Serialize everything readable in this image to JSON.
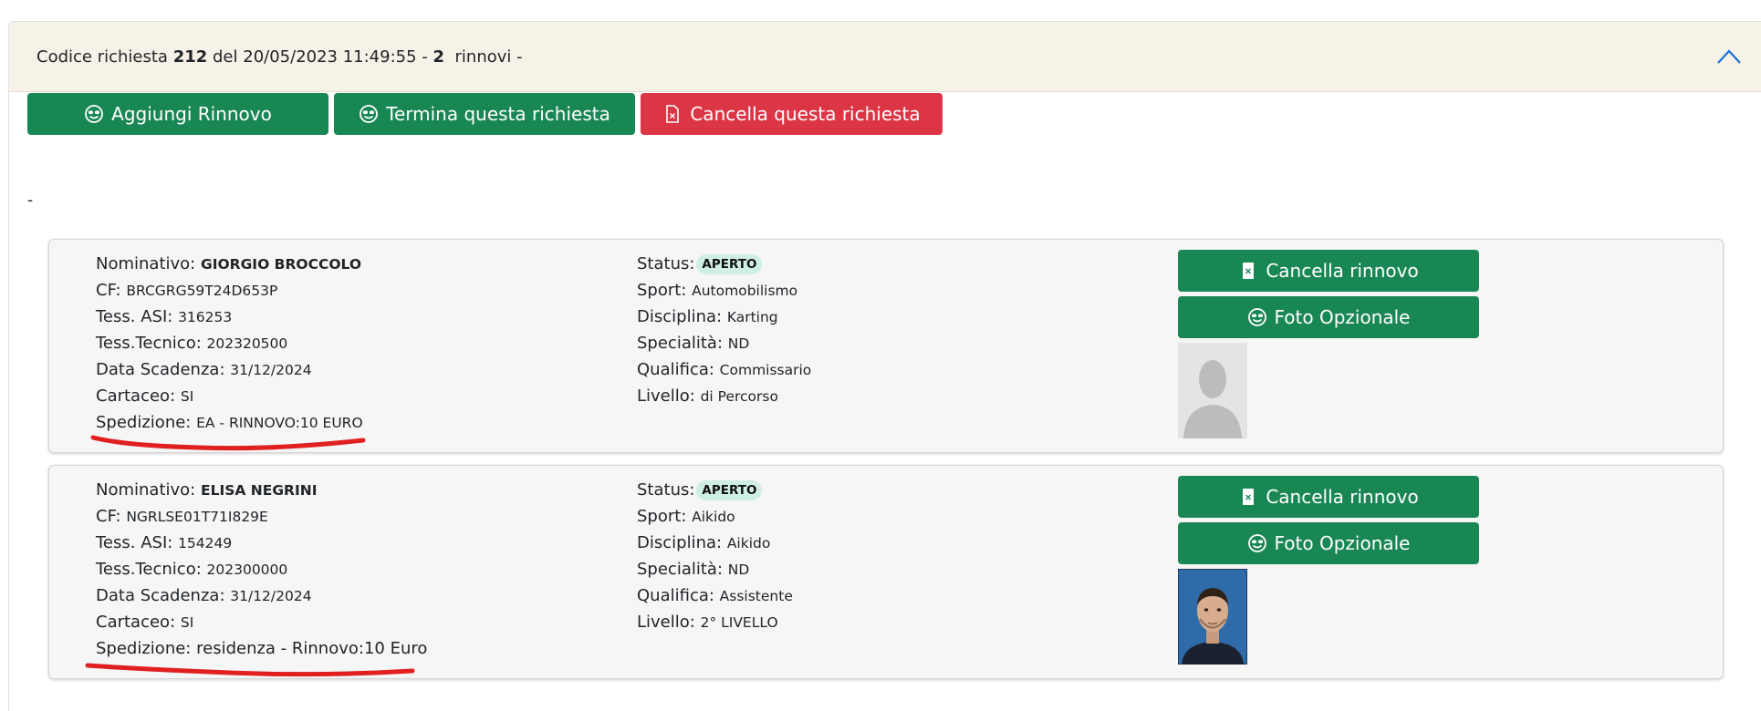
{
  "request": {
    "prefix": "Codice richiesta",
    "code": "212",
    "del": "del",
    "datetime": "20/05/2023 11:49:55",
    "sep1": "-",
    "renewals_count": "2",
    "renewals_word": "rinnovi",
    "sep2": "-"
  },
  "actions": {
    "add": "Aggiungi Rinnovo",
    "finish": "Termina questa richiesta",
    "cancel": "Cancella questa richiesta"
  },
  "note": "-",
  "labels": {
    "nominativo": "Nominativo:",
    "cf": "CF:",
    "tess_asi": "Tess. ASI:",
    "tess_tecnico": "Tess.Tecnico:",
    "data_scadenza": "Data Scadenza:",
    "cartaceo": "Cartaceo:",
    "spedizione": "Spedizione:",
    "status": "Status:",
    "sport": "Sport:",
    "disciplina": "Disciplina:",
    "specialita": "Specialità:",
    "qualifica": "Qualifica:",
    "livello": "Livello:",
    "cancel_renewal": "Cancella rinnovo",
    "optional_photo": "Foto Opzionale"
  },
  "renewals": [
    {
      "nominativo": "GIORGIO BROCCOLO",
      "cf": "BRCGRG59T24D653P",
      "tess_asi": "316253",
      "tess_tecnico": "202320500",
      "data_scadenza": "31/12/2024",
      "cartaceo": "SI",
      "spedizione": "EA - RINNOVO:10 EURO",
      "status": "APERTO",
      "sport": "Automobilismo",
      "disciplina": "Karting",
      "specialita": "ND",
      "qualifica": "Commissario",
      "livello": "di Percorso",
      "photo": "placeholder-avatar"
    },
    {
      "nominativo": "ELISA NEGRINI",
      "cf": "NGRLSE01T71I829E",
      "tess_asi": "154249",
      "tess_tecnico": "202300000",
      "data_scadenza": "31/12/2024",
      "cartaceo": "SI",
      "spedizione": "residenza - Rinnovo:10 Euro",
      "status": "APERTO",
      "sport": "Aikido",
      "disciplina": "Aikido",
      "specialita": "ND",
      "qualifica": "Assistente",
      "livello": "2° LIVELLO",
      "photo": "portrait-photo"
    }
  ],
  "colors": {
    "header_bg": "#f7f2e7",
    "green": "#198754",
    "red": "#dc3545",
    "badge_bg": "#cfeee6",
    "annotation_red": "#e02020"
  }
}
